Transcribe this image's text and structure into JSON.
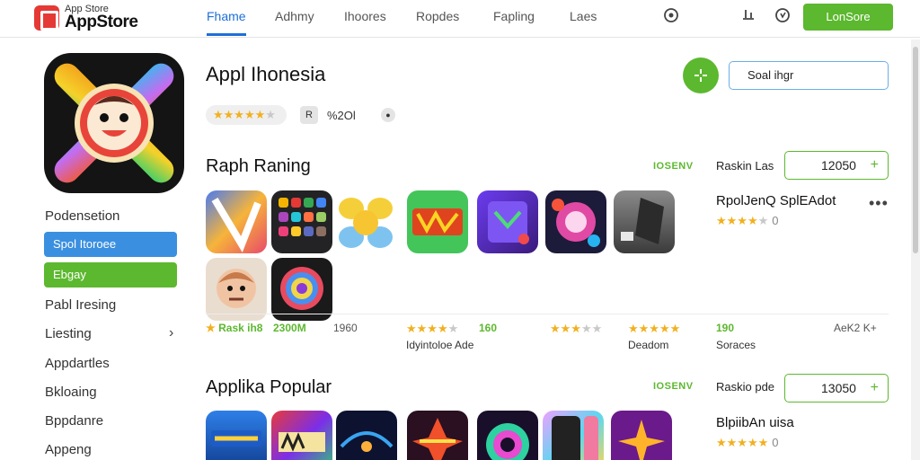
{
  "header": {
    "logo_small": "App Store",
    "logo_big": "AppStore",
    "tabs": [
      "Fhame",
      "Adhmy",
      "Ihoores",
      "Ropdes",
      "Fapling",
      "Laes"
    ],
    "cta_label": "LonSore"
  },
  "sidebar": {
    "section_title": "Podensetion",
    "btn_blue": "Spol Itoroee",
    "btn_green": "Ebgay",
    "items": [
      "Pabl Iresing",
      "Liesting",
      "Appdartles",
      "Bkloaing",
      "Bppdanre",
      "Appeng"
    ]
  },
  "app": {
    "title": "Appl Ihonesia",
    "rating_text": "%2Ol",
    "search_value": "Soal ihgr"
  },
  "section1": {
    "title": "Raph Raning",
    "tag": "IOSENV",
    "label": "Raskin Las",
    "counter": "12050",
    "featured_title": "RpolJenQ SplEAdot",
    "featured_rating_num": "0",
    "stats": [
      {
        "value": "Rask ih8",
        "kind": "green"
      },
      {
        "value": "2300M",
        "kind": "green"
      },
      {
        "value": "1960",
        "kind": "plain"
      },
      {
        "value": "160",
        "kind": "green"
      },
      {
        "value": "190",
        "kind": "green"
      },
      {
        "value": "AeK2 K+",
        "kind": "plain"
      }
    ],
    "stat_labels": [
      "Idyintoloe Ade",
      "Deadom",
      "Soraces"
    ]
  },
  "section2": {
    "title": "Applika Popular",
    "tag": "IOSENV",
    "label": "Raskio pde",
    "counter": "13050",
    "featured_title": "BlpiibAn uisa",
    "featured_rating_num": "0"
  },
  "icons": {
    "cart": "cart-icon",
    "mic": "mic-icon",
    "refresh": "refresh-icon"
  }
}
